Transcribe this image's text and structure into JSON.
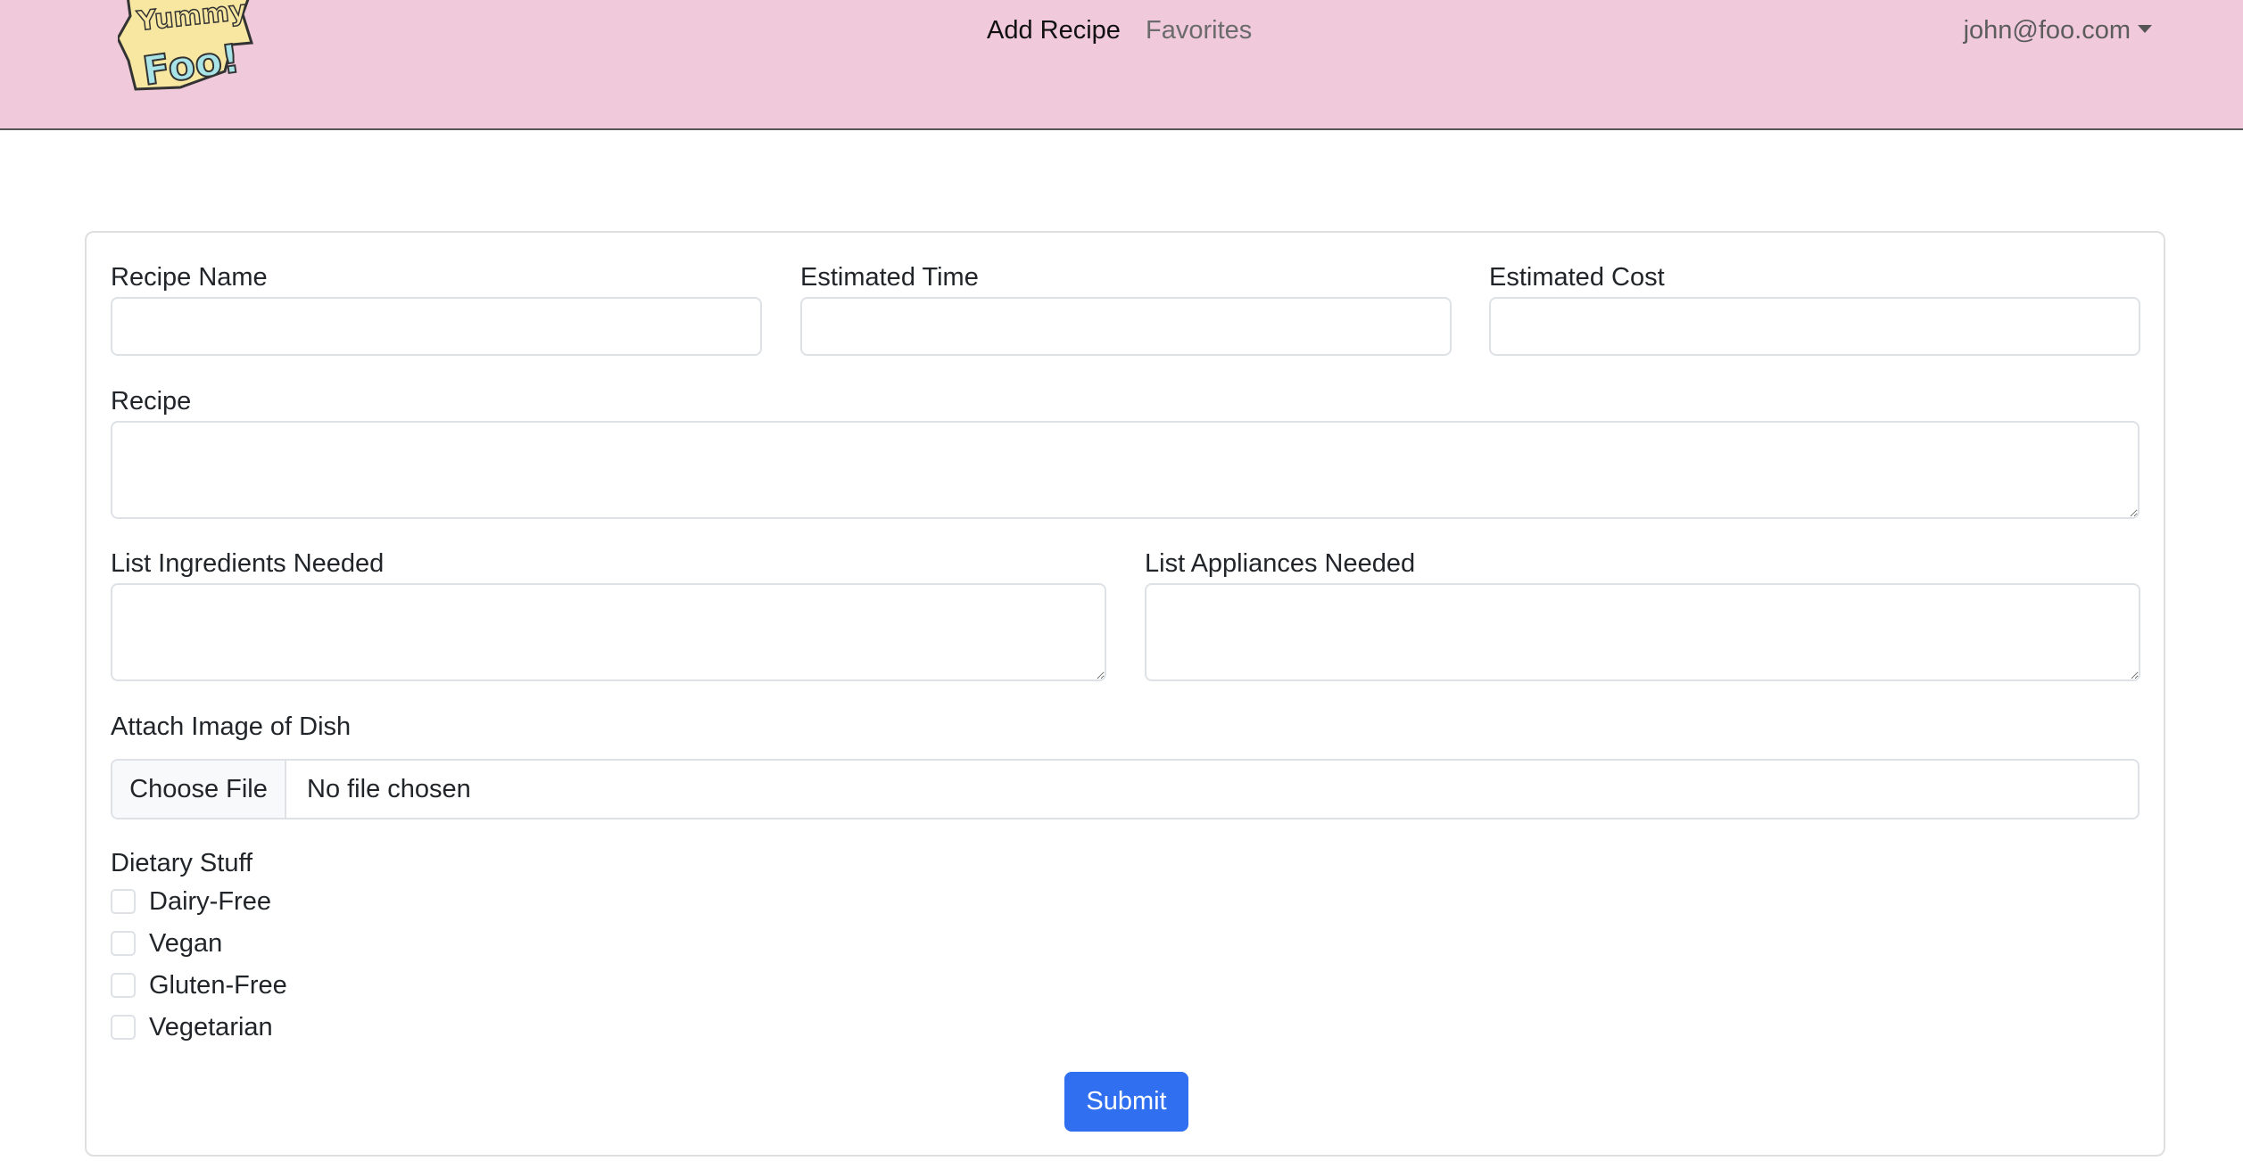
{
  "navbar": {
    "logo_text_top": "Yummy",
    "logo_text_bottom": "Foo!",
    "links": {
      "add_recipe": "Add Recipe",
      "favorites": "Favorites"
    },
    "user_email": "john@foo.com",
    "background": "#f0c9db"
  },
  "form": {
    "recipe_name": {
      "label": "Recipe Name",
      "value": ""
    },
    "estimated_time": {
      "label": "Estimated Time",
      "value": ""
    },
    "estimated_cost": {
      "label": "Estimated Cost",
      "value": ""
    },
    "recipe": {
      "label": "Recipe",
      "value": ""
    },
    "ingredients": {
      "label": "List Ingredients Needed",
      "value": ""
    },
    "appliances": {
      "label": "List Appliances Needed",
      "value": ""
    },
    "image": {
      "label": "Attach Image of Dish",
      "button": "Choose File",
      "status": "No file chosen"
    },
    "dietary": {
      "label": "Dietary Stuff",
      "options": [
        {
          "label": "Dairy-Free",
          "checked": false
        },
        {
          "label": "Vegan",
          "checked": false
        },
        {
          "label": "Gluten-Free",
          "checked": false
        },
        {
          "label": "Vegetarian",
          "checked": false
        }
      ]
    },
    "submit_label": "Submit",
    "accent": "#2f6ff0"
  }
}
